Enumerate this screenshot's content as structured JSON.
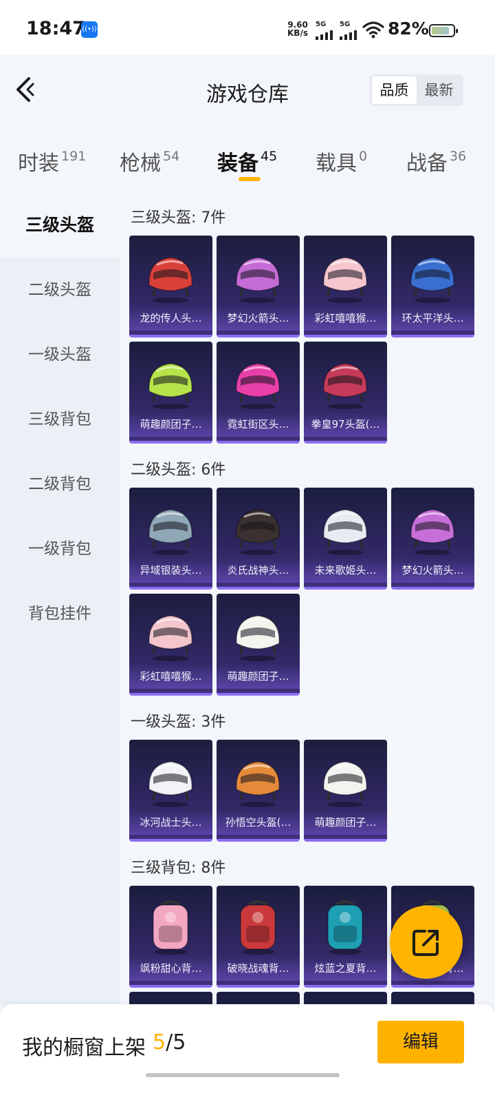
{
  "status_bar": {
    "time": "18:47",
    "app_icon": "notification-badge-icon",
    "net_speed_value": "9.60",
    "net_speed_unit": "KB/s",
    "signal1_label": "5G",
    "signal2_label": "5G",
    "battery_percent": "82%"
  },
  "header": {
    "title": "游戏仓库",
    "sort_options": [
      "品质",
      "最新"
    ],
    "sort_selected": "品质"
  },
  "tabs": [
    {
      "label": "时装",
      "count": "191"
    },
    {
      "label": "枪械",
      "count": "54"
    },
    {
      "label": "装备",
      "count": "45",
      "active": true
    },
    {
      "label": "载具",
      "count": "0"
    },
    {
      "label": "战备",
      "count": "36"
    }
  ],
  "sidebar": {
    "items": [
      "三级头盔",
      "二级头盔",
      "一级头盔",
      "三级背包",
      "二级背包",
      "一级背包",
      "背包挂件"
    ],
    "active": "三级头盔"
  },
  "sections": [
    {
      "title": "三级头盔: 7件",
      "items": [
        {
          "name": "龙的传人头…",
          "color": "#d9403a"
        },
        {
          "name": "梦幻火箭头…",
          "color": "#c56bd6"
        },
        {
          "name": "彩虹嘻嘻猴…",
          "color": "#f6c6cf"
        },
        {
          "name": "环太平洋头…",
          "color": "#3a6fd0"
        },
        {
          "name": "萌趣颜团子…",
          "color": "#b7e34a"
        },
        {
          "name": "霓虹街区头…",
          "color": "#e83fa9"
        },
        {
          "name": "拳皇97头盔(…",
          "color": "#c63a5a"
        }
      ]
    },
    {
      "title": "二级头盔: 6件",
      "items": [
        {
          "name": "异域银装头…",
          "color": "#8fa7b6"
        },
        {
          "name": "炎氏战神头…",
          "color": "#3b3130"
        },
        {
          "name": "未来歌姬头…",
          "color": "#e8ecf2"
        },
        {
          "name": "梦幻火箭头…",
          "color": "#c66fd8"
        },
        {
          "name": "彩虹嘻嘻猴…",
          "color": "#f3c5cd"
        },
        {
          "name": "萌趣颜团子…",
          "color": "#f2f4ee"
        }
      ]
    },
    {
      "title": "一级头盔: 3件",
      "items": [
        {
          "name": "冰河战士头…",
          "color": "#f1f3f7"
        },
        {
          "name": "孙悟空头盔(…",
          "color": "#e48a3a"
        },
        {
          "name": "萌趣颜团子…",
          "color": "#f3f4f0"
        }
      ]
    },
    {
      "title": "三级背包: 8件",
      "items": [
        {
          "name": "飒粉甜心背…",
          "color": "#f3a6c2"
        },
        {
          "name": "破晓战魂背…",
          "color": "#c9393b"
        },
        {
          "name": "炫蓝之夏背…",
          "color": "#1f9fb4"
        },
        {
          "name": "恐龙宝宝背…",
          "color": "#a4c552"
        }
      ]
    }
  ],
  "fab": {
    "icon": "share-external-icon"
  },
  "bottom_bar": {
    "label": "我的橱窗上架",
    "current": "5",
    "separator": "/",
    "total": "5",
    "edit_label": "编辑"
  }
}
